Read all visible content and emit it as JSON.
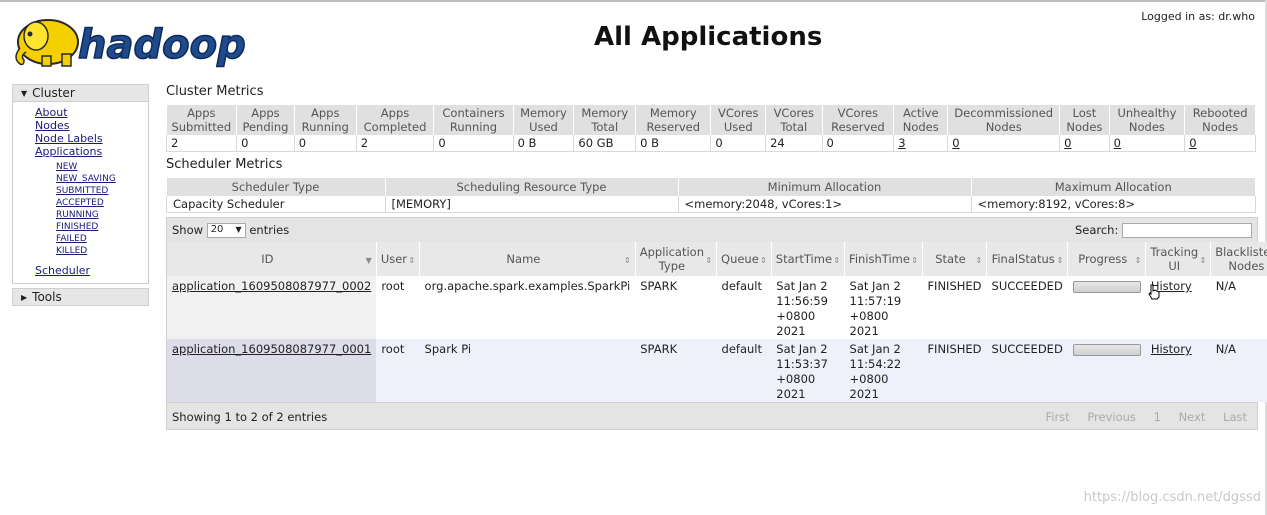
{
  "header": {
    "logo_text": "hadoop",
    "title": "All Applications",
    "logged_in": "Logged in as: dr.who"
  },
  "sidebar": {
    "cluster_label": "Cluster",
    "links": [
      "About",
      "Nodes",
      "Node Labels",
      "Applications"
    ],
    "app_states": [
      "NEW",
      "NEW_SAVING",
      "SUBMITTED",
      "ACCEPTED",
      "RUNNING",
      "FINISHED",
      "FAILED",
      "KILLED"
    ],
    "scheduler_label": "Scheduler",
    "tools_label": "Tools"
  },
  "cluster_metrics": {
    "title": "Cluster Metrics",
    "headers": [
      "Apps Submitted",
      "Apps Pending",
      "Apps Running",
      "Apps Completed",
      "Containers Running",
      "Memory Used",
      "Memory Total",
      "Memory Reserved",
      "VCores Used",
      "VCores Total",
      "VCores Reserved",
      "Active Nodes",
      "Decommissioned Nodes",
      "Lost Nodes",
      "Unhealthy Nodes",
      "Rebooted Nodes"
    ],
    "values": [
      "2",
      "0",
      "0",
      "2",
      "0",
      "0 B",
      "60 GB",
      "0 B",
      "0",
      "24",
      "0",
      "3",
      "0",
      "0",
      "0",
      "0"
    ]
  },
  "scheduler_metrics": {
    "title": "Scheduler Metrics",
    "headers": [
      "Scheduler Type",
      "Scheduling Resource Type",
      "Minimum Allocation",
      "Maximum Allocation"
    ],
    "values": [
      "Capacity Scheduler",
      "[MEMORY]",
      "<memory:2048, vCores:1>",
      "<memory:8192, vCores:8>"
    ]
  },
  "apps_table": {
    "show_label": "Show",
    "entries_value": "20",
    "entries_label": "entries",
    "search_label": "Search:",
    "headers": [
      "ID",
      "User",
      "Name",
      "Application Type",
      "Queue",
      "StartTime",
      "FinishTime",
      "State",
      "FinalStatus",
      "Progress",
      "Tracking UI",
      "Blacklisted Nodes"
    ],
    "rows": [
      {
        "id": "application_1609508087977_0002",
        "user": "root",
        "name": "org.apache.spark.examples.SparkPi",
        "type": "SPARK",
        "queue": "default",
        "start": [
          "Sat Jan 2",
          "11:56:59",
          "+0800",
          "2021"
        ],
        "finish": [
          "Sat Jan 2",
          "11:57:19",
          "+0800",
          "2021"
        ],
        "state": "FINISHED",
        "final_status": "SUCCEEDED",
        "progress": 1.0,
        "tracking": "History",
        "blacklisted": "N/A"
      },
      {
        "id": "application_1609508087977_0001",
        "user": "root",
        "name": "Spark Pi",
        "type": "SPARK",
        "queue": "default",
        "start": [
          "Sat Jan 2",
          "11:53:37",
          "+0800",
          "2021"
        ],
        "finish": [
          "Sat Jan 2",
          "11:54:22",
          "+0800",
          "2021"
        ],
        "state": "FINISHED",
        "final_status": "SUCCEEDED",
        "progress": 1.0,
        "tracking": "History",
        "blacklisted": "N/A"
      }
    ],
    "info": "Showing 1 to 2 of 2 entries",
    "pager": [
      "First",
      "Previous",
      "1",
      "Next",
      "Last"
    ]
  },
  "watermark": "https://blog.csdn.net/dgssd"
}
